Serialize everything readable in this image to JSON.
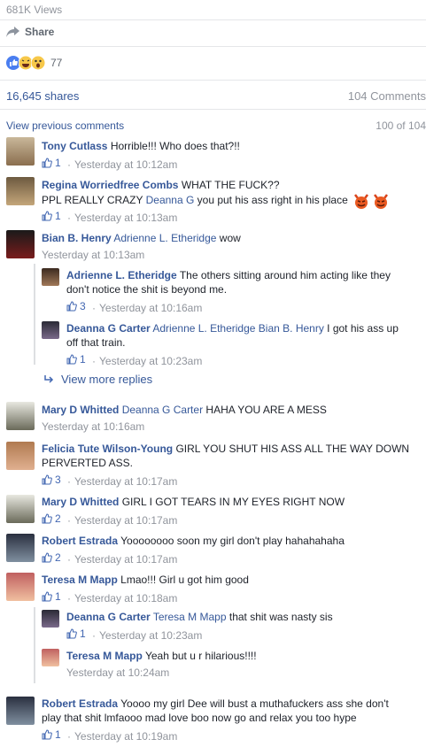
{
  "post": {
    "views": "681K Views",
    "share_label": "Share",
    "reaction_count": "77",
    "shares": "16,645 shares",
    "comments_count": "104 Comments"
  },
  "comments_header": {
    "view_previous": "View previous comments",
    "paging": "100 of 104"
  },
  "comments": [
    {
      "name": "Tony Cutlass",
      "text": "Horrible!!! Who does that?!!",
      "likes": "1",
      "time": "Yesterday at 10:12am"
    },
    {
      "name": "Regina Worriedfree Combs",
      "text1": "WHAT THE FUCK??",
      "text2a": "PPL REALLY CRAZY ",
      "mention": "Deanna G",
      "text2b": " you put his ass right in his place",
      "likes": "1",
      "time": "Yesterday at 10:13am"
    },
    {
      "name": "Bian B. Henry",
      "mention": "Adrienne L. Etheridge",
      "text": " wow",
      "time": "Yesterday at 10:13am",
      "replies": [
        {
          "name": "Adrienne L. Etheridge",
          "text": "The others sitting around him acting like they don't notice the shit is beyond me.",
          "likes": "3",
          "time": "Yesterday at 10:16am"
        },
        {
          "name": "Deanna G Carter",
          "mention": "Adrienne L. Etheridge Bian B. Henry",
          "text": " I got his ass up off that train.",
          "likes": "1",
          "time": "Yesterday at 10:23am"
        }
      ],
      "more_replies": "View more replies"
    },
    {
      "name": "Mary D Whitted",
      "mention": "Deanna G Carter",
      "text": " HAHA YOU ARE A MESS",
      "time": "Yesterday at 10:16am"
    },
    {
      "name": "Felicia Tute Wilson-Young",
      "text": "GIRL YOU SHUT HIS ASS ALL THE WAY DOWN PERVERTED ASS.",
      "likes": "3",
      "time": "Yesterday at 10:17am"
    },
    {
      "name": "Mary D Whitted",
      "text": "GIRL I GOT TEARS IN MY EYES RIGHT NOW",
      "likes": "2",
      "time": "Yesterday at 10:17am"
    },
    {
      "name": "Robert Estrada",
      "text": "Yoooooooo soon my girl don't play hahahahaha",
      "likes": "2",
      "time": "Yesterday at 10:17am"
    },
    {
      "name": "Teresa M Mapp",
      "text": "Lmao!!! Girl u got him good",
      "likes": "1",
      "time": "Yesterday at 10:18am",
      "replies": [
        {
          "name": "Deanna G Carter",
          "mention": "Teresa M Mapp",
          "text": " that shit was nasty sis",
          "likes": "1",
          "time": "Yesterday at 10:23am"
        },
        {
          "name": "Teresa M Mapp",
          "text": "Yeah but u r hilarious!!!!",
          "time": "Yesterday at 10:24am"
        }
      ]
    },
    {
      "name": "Robert Estrada",
      "text": "Yoooo my girl Dee will bust a muthafuckers ass she don't play that shit lmfaooo mad love boo now go and relax you too hype",
      "likes": "1",
      "time": "Yesterday at 10:19am"
    }
  ],
  "colors": {
    "link": "#365899",
    "like": "#4267b2",
    "meta": "#90949c",
    "divider": "#e5e6e9"
  },
  "icons": [
    "share-icon",
    "like-reaction-icon",
    "haha-reaction-icon",
    "wow-reaction-icon",
    "thumb-up-icon",
    "reply-arrow-icon",
    "devil-emoji-icon"
  ]
}
